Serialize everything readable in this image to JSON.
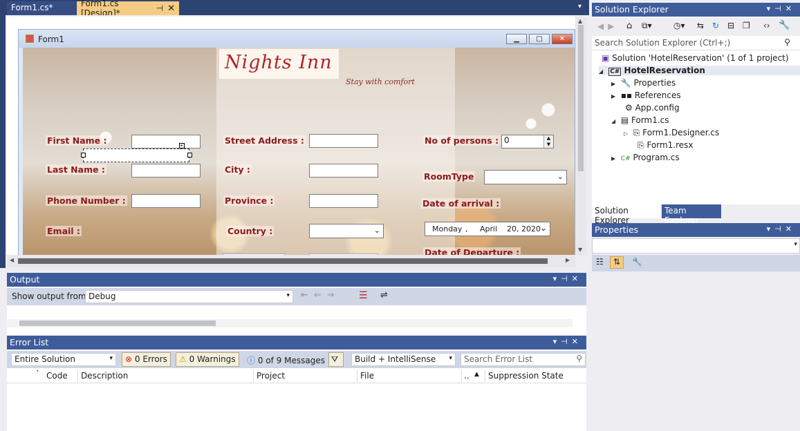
{
  "tabs": {
    "tab1": "Form1.cs*",
    "tab2": "Form1.cs [Design]*"
  },
  "form": {
    "title": "Form1",
    "brand": "Nights Inn",
    "tagline": "Stay with comfort",
    "labels": {
      "first_name": "First Name :",
      "last_name": "Last Name :",
      "phone": "Phone Number :",
      "email": "Email :",
      "street": "Street Address :",
      "city": "City :",
      "province": "Province :",
      "country": "Country :",
      "persons": "No of persons  :",
      "room_type": "RoomType",
      "arrival": "Date of arrival  :",
      "departure": "Date of Departure  :"
    },
    "persons_value": "0",
    "date": {
      "day": "Monday",
      "sep": ",",
      "month": "April",
      "rest": "20, 2020"
    }
  },
  "output": {
    "title": "Output",
    "show_from_label": "Show output from:",
    "source": "Debug"
  },
  "error_list": {
    "title": "Error List",
    "scope": "Entire Solution",
    "errors": "0 Errors",
    "warnings": "0 Warnings",
    "messages": "0 of 9 Messages",
    "build": "Build + IntelliSense",
    "search_placeholder": "Search Error List",
    "columns": {
      "code": "Code",
      "description": "Description",
      "project": "Project",
      "file": "File",
      "line": "..",
      "suppression": "Suppression State"
    }
  },
  "solution_explorer": {
    "title": "Solution Explorer",
    "search_placeholder": "Search Solution Explorer (Ctrl+;)",
    "items": [
      "Solution 'HotelReservation' (1 of 1 project)",
      "HotelReservation",
      "Properties",
      "References",
      "App.config",
      "Form1.cs",
      "Form1.Designer.cs",
      "Form1.resx",
      "Program.cs"
    ],
    "tab_solution": "Solution Explorer",
    "tab_team": "Team Explorer"
  },
  "properties": {
    "title": "Properties"
  },
  "colors": {
    "accent": "#3f5c9a",
    "active_tab": "#f5cc84",
    "label_red": "#8b1a1a"
  }
}
